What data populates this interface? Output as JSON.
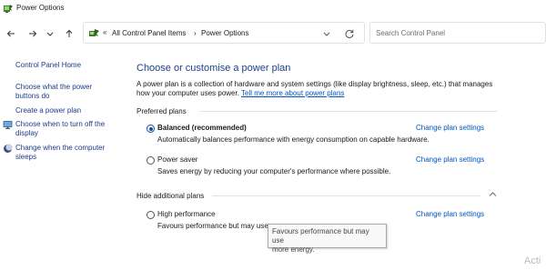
{
  "window": {
    "title": "Power Options"
  },
  "nav": {
    "address_icon": "control-panel-icon",
    "address_separator": "«",
    "breadcrumb": [
      "All Control Panel Items",
      "Power Options"
    ],
    "breadcrumb_separator": "›",
    "search_placeholder": "Search Control Panel"
  },
  "sidebar": {
    "home": "Control Panel Home",
    "items": [
      {
        "label_lines": [
          "Choose what the power",
          "buttons do"
        ]
      },
      {
        "label_lines": [
          "Create a power plan"
        ]
      },
      {
        "label_lines": [
          "Choose when to turn off the",
          "display"
        ],
        "icon": "monitor-icon"
      },
      {
        "label_lines": [
          "Change when the computer",
          "sleeps"
        ],
        "icon": "moon-icon"
      }
    ]
  },
  "main": {
    "heading": "Choose or customise a power plan",
    "description_lines": [
      "A power plan is a collection of hardware and system settings (like display brightness, sleep, etc.) that manages",
      "how your computer uses power."
    ],
    "learn_more_link": "Tell me more about power plans",
    "preferred_label": "Preferred plans",
    "hidden_label": "Hide additional plans",
    "plans": [
      {
        "name": "Balanced (recommended)",
        "description": "Automatically balances performance with energy consumption on capable hardware.",
        "selected": true,
        "change_link": "Change plan settings"
      },
      {
        "name": "Power saver",
        "description": "Saves energy by reducing your computer's performance where possible.",
        "selected": false,
        "change_link": "Change plan settings"
      },
      {
        "name": "High performance",
        "description": "Favours performance but may use",
        "selected": false,
        "change_link": "Change plan settings"
      }
    ]
  },
  "tooltip": {
    "lines": [
      "Favours performance but may use",
      "more energy."
    ]
  },
  "watermark": "Acti"
}
